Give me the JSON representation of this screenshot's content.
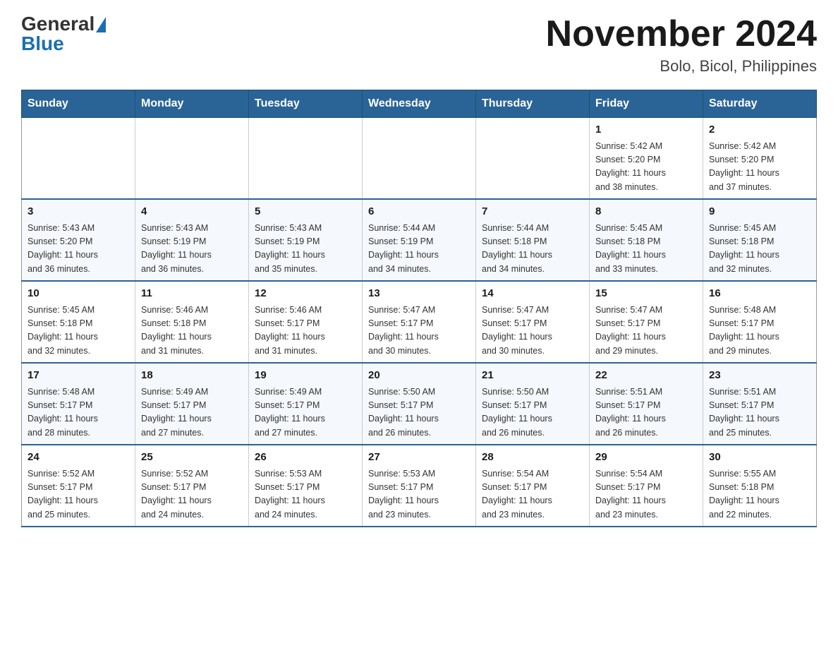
{
  "header": {
    "logo_general": "General",
    "logo_blue": "Blue",
    "title": "November 2024",
    "location": "Bolo, Bicol, Philippines"
  },
  "calendar": {
    "days_of_week": [
      "Sunday",
      "Monday",
      "Tuesday",
      "Wednesday",
      "Thursday",
      "Friday",
      "Saturday"
    ],
    "weeks": [
      [
        {
          "day": "",
          "info": ""
        },
        {
          "day": "",
          "info": ""
        },
        {
          "day": "",
          "info": ""
        },
        {
          "day": "",
          "info": ""
        },
        {
          "day": "",
          "info": ""
        },
        {
          "day": "1",
          "info": "Sunrise: 5:42 AM\nSunset: 5:20 PM\nDaylight: 11 hours\nand 38 minutes."
        },
        {
          "day": "2",
          "info": "Sunrise: 5:42 AM\nSunset: 5:20 PM\nDaylight: 11 hours\nand 37 minutes."
        }
      ],
      [
        {
          "day": "3",
          "info": "Sunrise: 5:43 AM\nSunset: 5:20 PM\nDaylight: 11 hours\nand 36 minutes."
        },
        {
          "day": "4",
          "info": "Sunrise: 5:43 AM\nSunset: 5:19 PM\nDaylight: 11 hours\nand 36 minutes."
        },
        {
          "day": "5",
          "info": "Sunrise: 5:43 AM\nSunset: 5:19 PM\nDaylight: 11 hours\nand 35 minutes."
        },
        {
          "day": "6",
          "info": "Sunrise: 5:44 AM\nSunset: 5:19 PM\nDaylight: 11 hours\nand 34 minutes."
        },
        {
          "day": "7",
          "info": "Sunrise: 5:44 AM\nSunset: 5:18 PM\nDaylight: 11 hours\nand 34 minutes."
        },
        {
          "day": "8",
          "info": "Sunrise: 5:45 AM\nSunset: 5:18 PM\nDaylight: 11 hours\nand 33 minutes."
        },
        {
          "day": "9",
          "info": "Sunrise: 5:45 AM\nSunset: 5:18 PM\nDaylight: 11 hours\nand 32 minutes."
        }
      ],
      [
        {
          "day": "10",
          "info": "Sunrise: 5:45 AM\nSunset: 5:18 PM\nDaylight: 11 hours\nand 32 minutes."
        },
        {
          "day": "11",
          "info": "Sunrise: 5:46 AM\nSunset: 5:18 PM\nDaylight: 11 hours\nand 31 minutes."
        },
        {
          "day": "12",
          "info": "Sunrise: 5:46 AM\nSunset: 5:17 PM\nDaylight: 11 hours\nand 31 minutes."
        },
        {
          "day": "13",
          "info": "Sunrise: 5:47 AM\nSunset: 5:17 PM\nDaylight: 11 hours\nand 30 minutes."
        },
        {
          "day": "14",
          "info": "Sunrise: 5:47 AM\nSunset: 5:17 PM\nDaylight: 11 hours\nand 30 minutes."
        },
        {
          "day": "15",
          "info": "Sunrise: 5:47 AM\nSunset: 5:17 PM\nDaylight: 11 hours\nand 29 minutes."
        },
        {
          "day": "16",
          "info": "Sunrise: 5:48 AM\nSunset: 5:17 PM\nDaylight: 11 hours\nand 29 minutes."
        }
      ],
      [
        {
          "day": "17",
          "info": "Sunrise: 5:48 AM\nSunset: 5:17 PM\nDaylight: 11 hours\nand 28 minutes."
        },
        {
          "day": "18",
          "info": "Sunrise: 5:49 AM\nSunset: 5:17 PM\nDaylight: 11 hours\nand 27 minutes."
        },
        {
          "day": "19",
          "info": "Sunrise: 5:49 AM\nSunset: 5:17 PM\nDaylight: 11 hours\nand 27 minutes."
        },
        {
          "day": "20",
          "info": "Sunrise: 5:50 AM\nSunset: 5:17 PM\nDaylight: 11 hours\nand 26 minutes."
        },
        {
          "day": "21",
          "info": "Sunrise: 5:50 AM\nSunset: 5:17 PM\nDaylight: 11 hours\nand 26 minutes."
        },
        {
          "day": "22",
          "info": "Sunrise: 5:51 AM\nSunset: 5:17 PM\nDaylight: 11 hours\nand 26 minutes."
        },
        {
          "day": "23",
          "info": "Sunrise: 5:51 AM\nSunset: 5:17 PM\nDaylight: 11 hours\nand 25 minutes."
        }
      ],
      [
        {
          "day": "24",
          "info": "Sunrise: 5:52 AM\nSunset: 5:17 PM\nDaylight: 11 hours\nand 25 minutes."
        },
        {
          "day": "25",
          "info": "Sunrise: 5:52 AM\nSunset: 5:17 PM\nDaylight: 11 hours\nand 24 minutes."
        },
        {
          "day": "26",
          "info": "Sunrise: 5:53 AM\nSunset: 5:17 PM\nDaylight: 11 hours\nand 24 minutes."
        },
        {
          "day": "27",
          "info": "Sunrise: 5:53 AM\nSunset: 5:17 PM\nDaylight: 11 hours\nand 23 minutes."
        },
        {
          "day": "28",
          "info": "Sunrise: 5:54 AM\nSunset: 5:17 PM\nDaylight: 11 hours\nand 23 minutes."
        },
        {
          "day": "29",
          "info": "Sunrise: 5:54 AM\nSunset: 5:17 PM\nDaylight: 11 hours\nand 23 minutes."
        },
        {
          "day": "30",
          "info": "Sunrise: 5:55 AM\nSunset: 5:18 PM\nDaylight: 11 hours\nand 22 minutes."
        }
      ]
    ]
  }
}
